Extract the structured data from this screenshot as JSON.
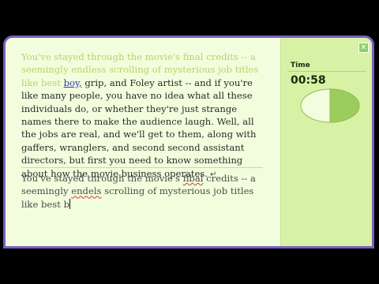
{
  "lesson": {
    "typed_part": "You've stayed through the movie's final credits -- a seemingly endless scrolling of mysterious job titles like best ",
    "current_word": "boy,",
    "remaining_part": " grip, and Foley artist -- and if you're like many people, you have no idea what all these individuals do, or whether they're just strange names there to make the audience laugh. Well, all the jobs are real, and we'll get to them, along with gaffers, wranglers, and second second assistant directors, but first you need to know something about how the movie business operates.",
    "return_symbol": "↵"
  },
  "input": {
    "seg1": "You've stayed through the movie's ",
    "err1": "fibal",
    "seg2": " credits -- a seemingly ",
    "err2": "endels",
    "seg3": " scrolling of mysterious job titles like best b"
  },
  "timer": {
    "label": "Time",
    "value": "00:58",
    "elapsed_fraction": 0.5
  },
  "colors": {
    "typed_text": "#b5d46a",
    "current_word": "#2a3ab0",
    "window_border": "#7a5fc0",
    "clock_fill": "#9ccc5e",
    "clock_face": "#f2fddd"
  },
  "icons": {
    "close": "close-icon"
  }
}
